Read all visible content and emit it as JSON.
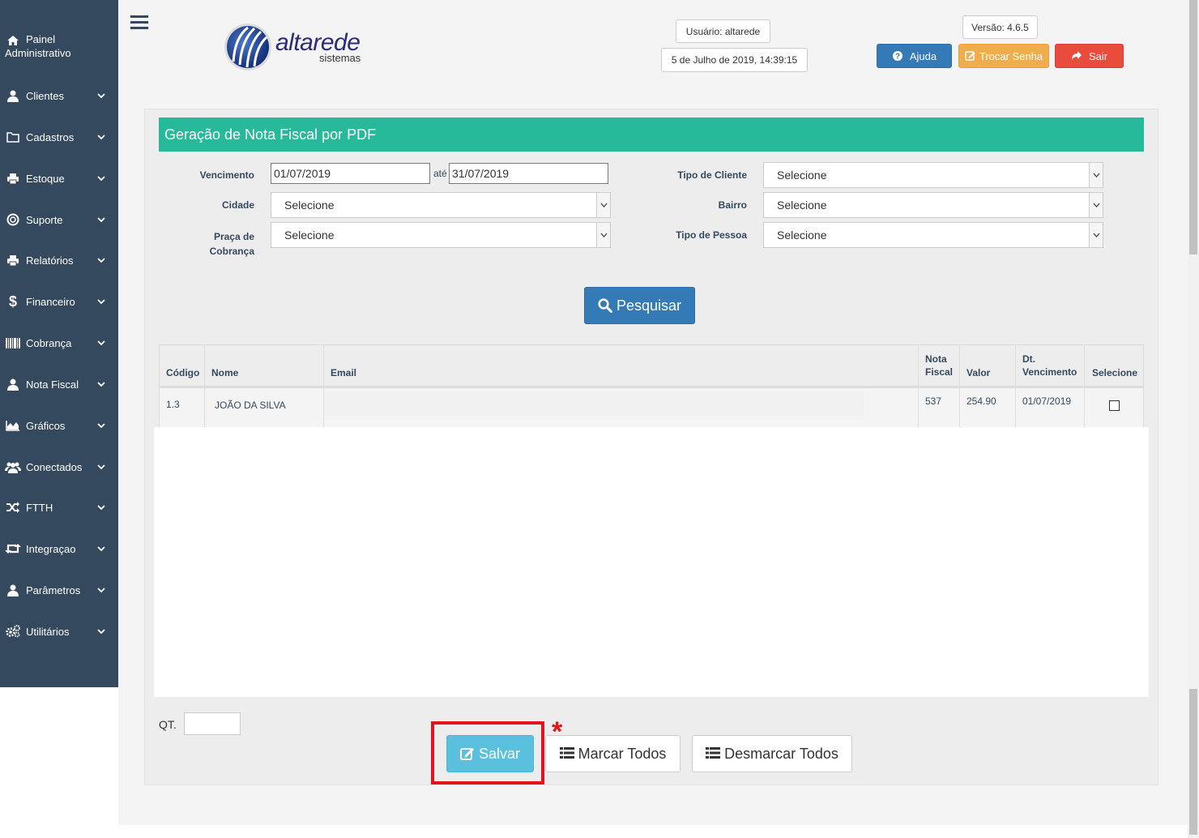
{
  "sidebar": {
    "items": [
      {
        "label_line1": "Painel",
        "label_line2": "Administrativo",
        "icon": "home-icon"
      },
      {
        "label": "Clientes",
        "icon": "user-icon"
      },
      {
        "label": "Cadastros",
        "icon": "folder-icon"
      },
      {
        "label": "Estoque",
        "icon": "printer-icon"
      },
      {
        "label": "Suporte",
        "icon": "lifebuoy-icon"
      },
      {
        "label": "Relatórios",
        "icon": "printer-icon"
      },
      {
        "label": "Financeiro",
        "icon": "dollar-icon"
      },
      {
        "label": "Cobrança",
        "icon": "barcode-icon"
      },
      {
        "label": "Nota Fiscal",
        "icon": "user-icon"
      },
      {
        "label": "Gráficos",
        "icon": "area-chart-icon"
      },
      {
        "label": "Conectados",
        "icon": "users-icon"
      },
      {
        "label": "FTTH",
        "icon": "shuffle-icon"
      },
      {
        "label": "Integraçao",
        "icon": "retweet-icon"
      },
      {
        "label": "Parâmetros",
        "icon": "user-icon"
      },
      {
        "label": "Utilitários",
        "icon": "gears-icon"
      }
    ]
  },
  "header": {
    "logo_name": "altarede",
    "logo_sub": "sistemas",
    "user": "Usuário: altarede",
    "datetime": "5 de Julho de 2019, 14:39:15",
    "version": "Versão: 4.6.5",
    "help_label": "Ajuda",
    "change_password_label": "Trocar Senha",
    "logout_label": "Sair"
  },
  "colors": {
    "sidebar": "#34495e",
    "panel_head": "#26b99a",
    "help": "#337ab7",
    "change_password": "#f0ad4e",
    "logout": "#e74c3c",
    "save": "#5bc0de",
    "highlight": "#e2131b"
  },
  "form": {
    "title": "Geração de Nota Fiscal por PDF",
    "vencimento_label": "Vencimento",
    "date_from": "01/07/2019",
    "ate_label": "até",
    "date_to": "31/07/2019",
    "cidade_label": "Cidade",
    "cidade_value": "Selecione",
    "praca_label_1": "Praça de",
    "praca_label_2": "Cobrança",
    "praca_value": "Selecione",
    "tipo_cliente_label": "Tipo de Cliente",
    "tipo_cliente_value": "Selecione",
    "bairro_label": "Bairro",
    "bairro_value": "Selecione",
    "tipo_pessoa_label": "Tipo de Pessoa",
    "tipo_pessoa_value": "Selecione",
    "search_label": "Pesquisar"
  },
  "table": {
    "headers": {
      "codigo": "Código",
      "nome": "Nome",
      "email": "Email",
      "nota_1": "Nota",
      "nota_2": "Fiscal",
      "valor": "Valor",
      "venc_1": "Dt.",
      "venc_2": "Vencimento",
      "selecione": "Selecione"
    },
    "rows": [
      {
        "codigo": "1.3",
        "nome": "JOÃO DA SILVA",
        "email": "",
        "nota_fiscal": "537",
        "valor": "254.90",
        "vencimento": "01/07/2019",
        "selected": false
      }
    ]
  },
  "footer": {
    "qt_label": "QT.",
    "qt_value": "",
    "save_label": "Salvar",
    "mark_all_label": "Marcar Todos",
    "unmark_all_label": "Desmarcar Todos",
    "asterisk": "*"
  }
}
